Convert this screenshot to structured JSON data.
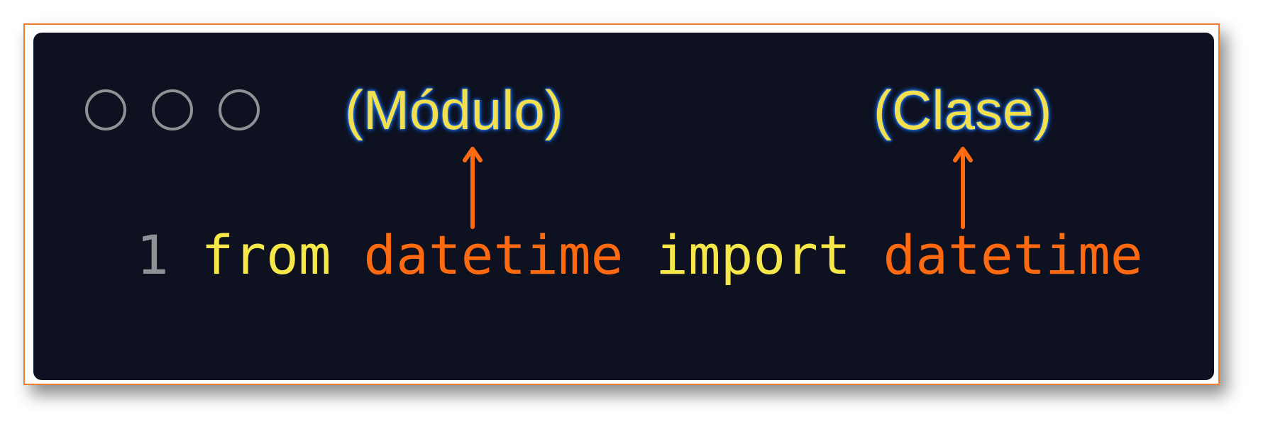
{
  "window": {
    "controls": [
      "circle-icon",
      "circle-icon",
      "circle-icon"
    ]
  },
  "annotations": {
    "module_label": "(Módulo)",
    "class_label": "(Clase)"
  },
  "code": {
    "line_number": "1",
    "tokens": {
      "from": "from",
      "module": "datetime",
      "import": "import",
      "class": "datetime"
    }
  },
  "colors": {
    "editor_background": "#0d1120",
    "keyword": "#f7e84a",
    "identifier": "#ff6a10",
    "line_number": "#8f9194",
    "annotation_text": "#f4e04d",
    "annotation_glow": "#1a73ff",
    "frame_border": "#ed7d31"
  }
}
